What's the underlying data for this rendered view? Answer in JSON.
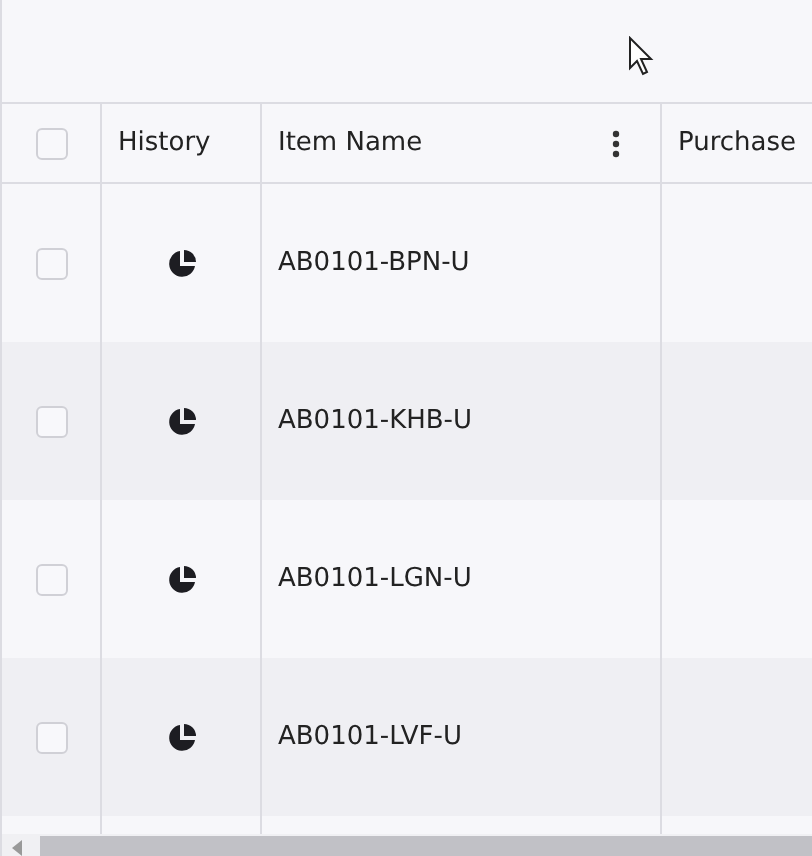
{
  "table": {
    "columns": [
      {
        "label": "History"
      },
      {
        "label": "Item Name",
        "menu": true
      },
      {
        "label": "Purchase"
      }
    ],
    "header_checkbox": {
      "checked": false
    },
    "rows": [
      {
        "checked": false,
        "item_name": "AB0101-BPN-U"
      },
      {
        "checked": false,
        "item_name": "AB0101-KHB-U"
      },
      {
        "checked": false,
        "item_name": "AB0101-LGN-U"
      },
      {
        "checked": false,
        "item_name": "AB0101-LVF-U"
      }
    ]
  }
}
